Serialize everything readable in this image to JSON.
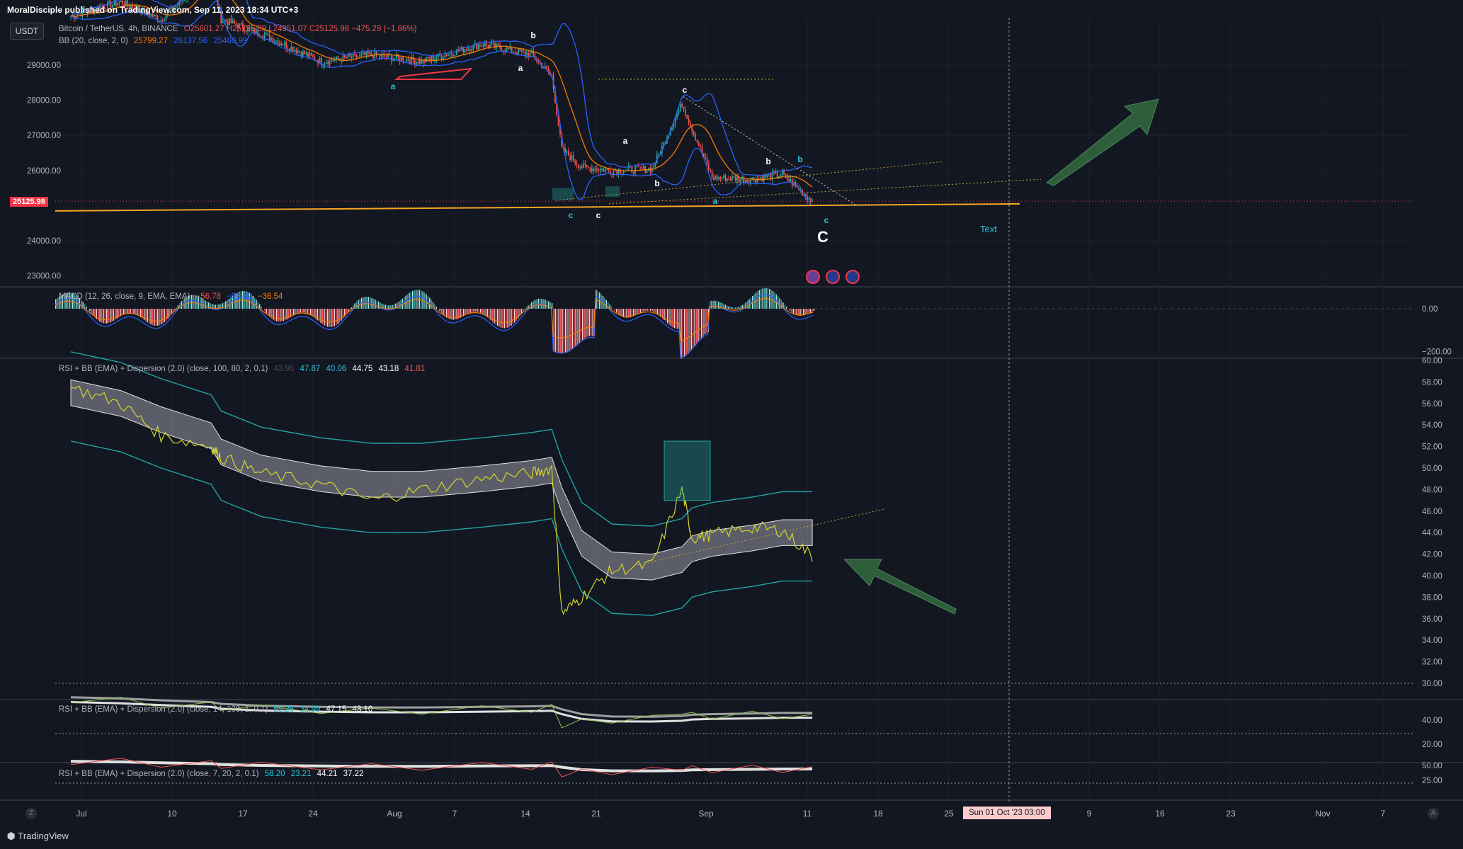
{
  "publisher": "MoralDisciple published on TradingView.com, Sep 11, 2023 18:34 UTC+3",
  "currency_button": "USDT",
  "main_legend": {
    "symbol": "Bitcoin / TetherUS, 4h, BINANCE",
    "ohlc": "O25601.27 H25756.39 L24951.07 C25125.98 −475.29 (−1.86%)",
    "bb_label": "BB (20, close, 2, 0)",
    "bb_basis": "25799.27",
    "bb_upper": "26137.56",
    "bb_lower": "25460.99"
  },
  "price_tag": "25125.98",
  "macd_legend": {
    "label": "MACD (12, 26, close, 9, EMA, EMA)",
    "hist": "−56.78",
    "macd": "−93.32",
    "signal": "−36.54"
  },
  "rsi1_legend": {
    "label": "RSI + BB (EMA) + Dispersion (2.0) (close, 100, 80, 2, 0.1)",
    "v1": "43.96",
    "v2": "47.87",
    "v3": "40.06",
    "v4": "44.75",
    "v5": "43.18",
    "v6": "41.81"
  },
  "rsi2_legend": {
    "label": "RSI + BB (EMA) + Dispersion (2.0) (close, 14, 100, 1, 0.1)",
    "v1": "55.26",
    "v2": "34.99",
    "v3": "47.15",
    "v4": "43.10"
  },
  "rsi3_legend": {
    "label": "RSI + BB (EMA) + Dispersion (2.0) (close, 7, 20, 2, 0.1)",
    "v1": "58.20",
    "v2": "23.21",
    "v3": "44.21",
    "v4": "37.22"
  },
  "time_tag": "Sun 01 Oct '23   03:00",
  "logo_text": "TradingView",
  "colors": {
    "background": "#131722",
    "up": "#26a69a",
    "down": "#ef5350",
    "bb_basis": "#f57c00",
    "bb_band": "#2962ff",
    "support": "#f5a623",
    "arrow": "#2e5d3a",
    "rsi_band": "#1fa5a5"
  },
  "chart_data": [
    {
      "type": "candlestick",
      "title": "Bitcoin / TetherUS, 4h, BINANCE",
      "ylim": [
        22700,
        30000
      ],
      "y_ticks": [
        "29000.00",
        "28000.00",
        "27000.00",
        "26000.00",
        "24000.00",
        "23000.00"
      ],
      "y_tick_values": [
        29000,
        28000,
        27000,
        26000,
        24000,
        23000
      ],
      "x_ticks": [
        "Jul",
        "10",
        "17",
        "24",
        "Aug",
        "7",
        "14",
        "21",
        "Sep",
        "11",
        "18",
        "25",
        "9",
        "16",
        "23",
        "Nov",
        "7"
      ],
      "last_price": 25125.98,
      "close_series": {
        "dates": [
          "2023-06-29",
          "2023-07-04",
          "2023-07-08",
          "2023-07-13",
          "2023-07-14",
          "2023-07-18",
          "2023-07-24",
          "2023-07-29",
          "2023-08-03",
          "2023-08-09",
          "2023-08-14",
          "2023-08-16",
          "2023-08-17",
          "2023-08-19",
          "2023-08-22",
          "2023-08-26",
          "2023-08-29",
          "2023-08-30",
          "2023-09-01",
          "2023-09-05",
          "2023-09-08",
          "2023-09-11"
        ],
        "values": [
          30400,
          30800,
          30300,
          31600,
          30300,
          29900,
          29100,
          29300,
          29100,
          29600,
          29300,
          28700,
          26600,
          26100,
          26000,
          26050,
          27900,
          27200,
          25800,
          25750,
          25900,
          25126
        ]
      },
      "bb_upper_value": 26137.56,
      "bb_basis_value": 25799.27,
      "bb_lower_value": 25460.99,
      "support_line": {
        "from": [
          0,
          24850
        ],
        "to": [
          1,
          25050
        ]
      },
      "wave_labels": [
        "a",
        "b",
        "a",
        "b",
        "c",
        "c",
        "a",
        "b",
        "c",
        "a",
        "b",
        "c",
        "C"
      ],
      "annotation_text": "Text"
    },
    {
      "type": "bar",
      "title": "MACD (12, 26, close, 9, EMA, EMA)",
      "y_ticks": [
        "0.00",
        "−200.00"
      ],
      "y_tick_values": [
        0,
        -200
      ],
      "values_last": {
        "histogram": -56.78,
        "macd": -93.32,
        "signal": -36.54
      }
    },
    {
      "type": "line",
      "title": "RSI + BB (EMA) + Dispersion (2.0) (close, 100, 80, 2, 0.1)",
      "ylim": [
        30,
        60
      ],
      "y_ticks": [
        "60.00",
        "58.00",
        "56.00",
        "54.00",
        "52.00",
        "50.00",
        "48.00",
        "46.00",
        "44.00",
        "42.00",
        "40.00",
        "38.00",
        "36.00",
        "34.00",
        "32.00",
        "30.00"
      ],
      "y_tick_values": [
        60,
        58,
        56,
        54,
        52,
        50,
        48,
        46,
        44,
        42,
        40,
        38,
        36,
        34,
        32,
        30
      ],
      "series": [
        {
          "values": [
            57.5,
            56.0,
            53.0,
            52.0,
            51.0,
            49.5,
            48.5,
            47.0,
            48.0,
            49.0,
            49.5,
            50.0,
            36.5,
            38.0,
            40.5,
            41.0,
            48.0,
            43.5,
            43.8,
            44.5,
            44.2,
            41.8
          ]
        },
        {
          "values": [
            57.0,
            56.0,
            54.5,
            53.0,
            51.5,
            50.0,
            49.0,
            48.5,
            48.5,
            49.0,
            49.5,
            49.8,
            47.0,
            43.0,
            41.0,
            40.8,
            41.5,
            42.5,
            43.0,
            43.5,
            44.0,
            44.0
          ]
        }
      ]
    },
    {
      "type": "line",
      "title": "RSI + BB (EMA) + Dispersion (2.0) (close, 14, 100, 1, 0.1)",
      "y_ticks": [
        "40.00",
        "20.00"
      ],
      "y_tick_values": [
        40,
        20
      ]
    },
    {
      "type": "line",
      "title": "RSI + BB (EMA) + Dispersion (2.0) (close, 7, 20, 2, 0.1)",
      "y_ticks": [
        "50.00",
        "25.00"
      ],
      "y_tick_values": [
        50,
        25
      ]
    }
  ]
}
